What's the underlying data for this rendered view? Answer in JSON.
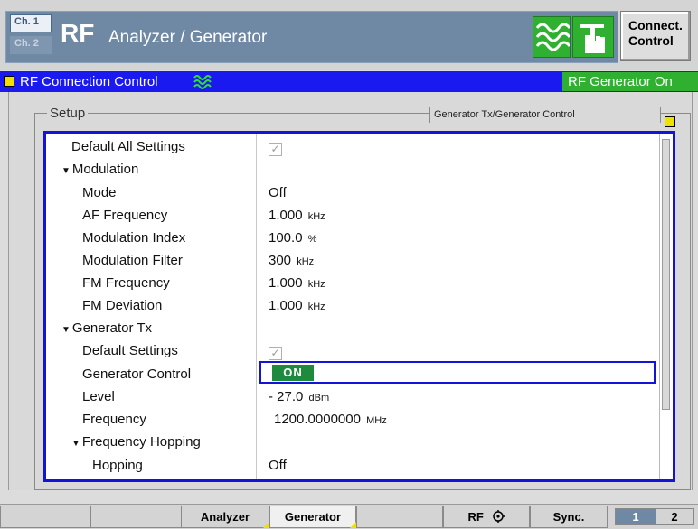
{
  "header": {
    "channel_1": "Ch. 1",
    "channel_2": "Ch. 2",
    "app_short": "RF",
    "app_title": "Analyzer / Generator",
    "connect_line1": "Connect.",
    "connect_line2": "Control"
  },
  "section": {
    "title": "RF Connection Control",
    "status": "RF Generator On"
  },
  "panel": {
    "legend": "Setup",
    "context": "Generator Tx/Generator Control"
  },
  "settings": {
    "default_all": {
      "label": "Default All Settings",
      "checked": true
    },
    "modulation": {
      "label": "Modulation"
    },
    "mode": {
      "label": "Mode",
      "value": "Off"
    },
    "af_frequency": {
      "label": "AF Frequency",
      "value": "1.000",
      "unit": "kHz"
    },
    "modulation_index": {
      "label": "Modulation Index",
      "value": "100.0",
      "unit": "%"
    },
    "modulation_filter": {
      "label": "Modulation Filter",
      "value": "300",
      "unit": "kHz"
    },
    "fm_frequency": {
      "label": "FM Frequency",
      "value": "1.000",
      "unit": "kHz"
    },
    "fm_deviation": {
      "label": "FM Deviation",
      "value": "1.000",
      "unit": "kHz"
    },
    "generator_tx": {
      "label": "Generator Tx"
    },
    "default_settings": {
      "label": "Default Settings",
      "checked": true
    },
    "generator_control": {
      "label": "Generator Control",
      "value": "ON"
    },
    "level": {
      "label": "Level",
      "value": "- 27.0",
      "unit": "dBm"
    },
    "frequency": {
      "label": "Frequency",
      "value": "1200.0000000",
      "unit": "MHz"
    },
    "frequency_hopping": {
      "label": "Frequency Hopping"
    },
    "hopping": {
      "label": "Hopping",
      "value": "Off"
    }
  },
  "softkeys": {
    "analyzer": "Analyzer",
    "generator": "Generator",
    "rf": "RF",
    "sync": "Sync.",
    "page_1": "1",
    "page_2": "2"
  },
  "colors": {
    "title_bar": "#6f88a4",
    "section_bar": "#1a1af0",
    "status_green": "#30b030",
    "selection_blue": "#1414d8",
    "on_badge": "#1e8a3e"
  }
}
